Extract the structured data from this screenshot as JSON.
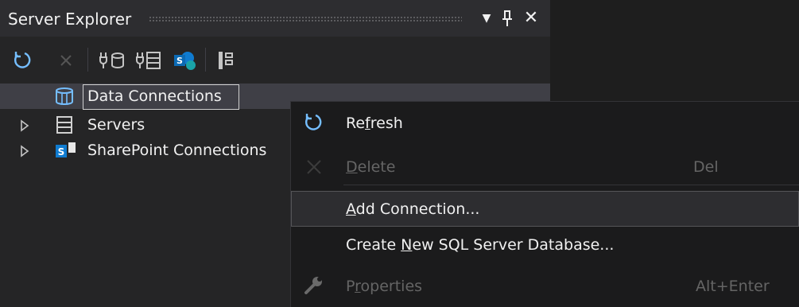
{
  "window": {
    "title": "Server Explorer",
    "dropdown_glyph": "▼",
    "pin_glyph": "չ",
    "close_glyph": "✕"
  },
  "toolbar": {
    "buttons": [
      {
        "name": "refresh",
        "icon": "refresh-icon",
        "enabled": true
      },
      {
        "name": "stop",
        "icon": "stop-icon",
        "enabled": false
      },
      {
        "name": "connect-to-database",
        "icon": "connect-database-icon",
        "enabled": true
      },
      {
        "name": "connect-to-server",
        "icon": "connect-server-icon",
        "enabled": true
      },
      {
        "name": "connect-to-sharepoint",
        "icon": "connect-sharepoint-icon",
        "enabled": true
      },
      {
        "name": "object-explorer",
        "icon": "tree-view-icon",
        "enabled": true
      }
    ]
  },
  "tree": {
    "items": [
      {
        "label": "Data Connections",
        "icon": "data-connections-icon",
        "expandable": false,
        "selected": true
      },
      {
        "label": "Servers",
        "icon": "servers-icon",
        "expandable": true,
        "selected": false
      },
      {
        "label": "SharePoint Connections",
        "icon": "sharepoint-icon",
        "expandable": true,
        "selected": false
      }
    ]
  },
  "context_menu": {
    "items": [
      {
        "pre": "Re",
        "accel": "f",
        "post": "resh",
        "shortcut": "",
        "icon": "refresh-icon",
        "enabled": true
      },
      {
        "pre": "",
        "accel": "D",
        "post": "elete",
        "shortcut": "Del",
        "icon": "delete-icon",
        "enabled": false
      },
      {
        "pre": "",
        "accel": "A",
        "post": "dd Connection...",
        "shortcut": "",
        "icon": "",
        "enabled": true,
        "hovered": true
      },
      {
        "pre": "Create ",
        "accel": "N",
        "post": "ew SQL Server Database...",
        "shortcut": "",
        "icon": "",
        "enabled": true
      },
      {
        "pre": "P",
        "accel": "r",
        "post": "operties",
        "shortcut": "Alt+Enter",
        "icon": "wrench-icon",
        "enabled": false
      }
    ]
  },
  "colors": {
    "panel_bg": "#252526",
    "menu_bg": "#1b1b1c",
    "text": "#f1f1f1",
    "disabled_text": "#656565",
    "accent_blue": "#75beff",
    "sharepoint_blue": "#0f7bd0",
    "selection": "#3f3f46"
  }
}
